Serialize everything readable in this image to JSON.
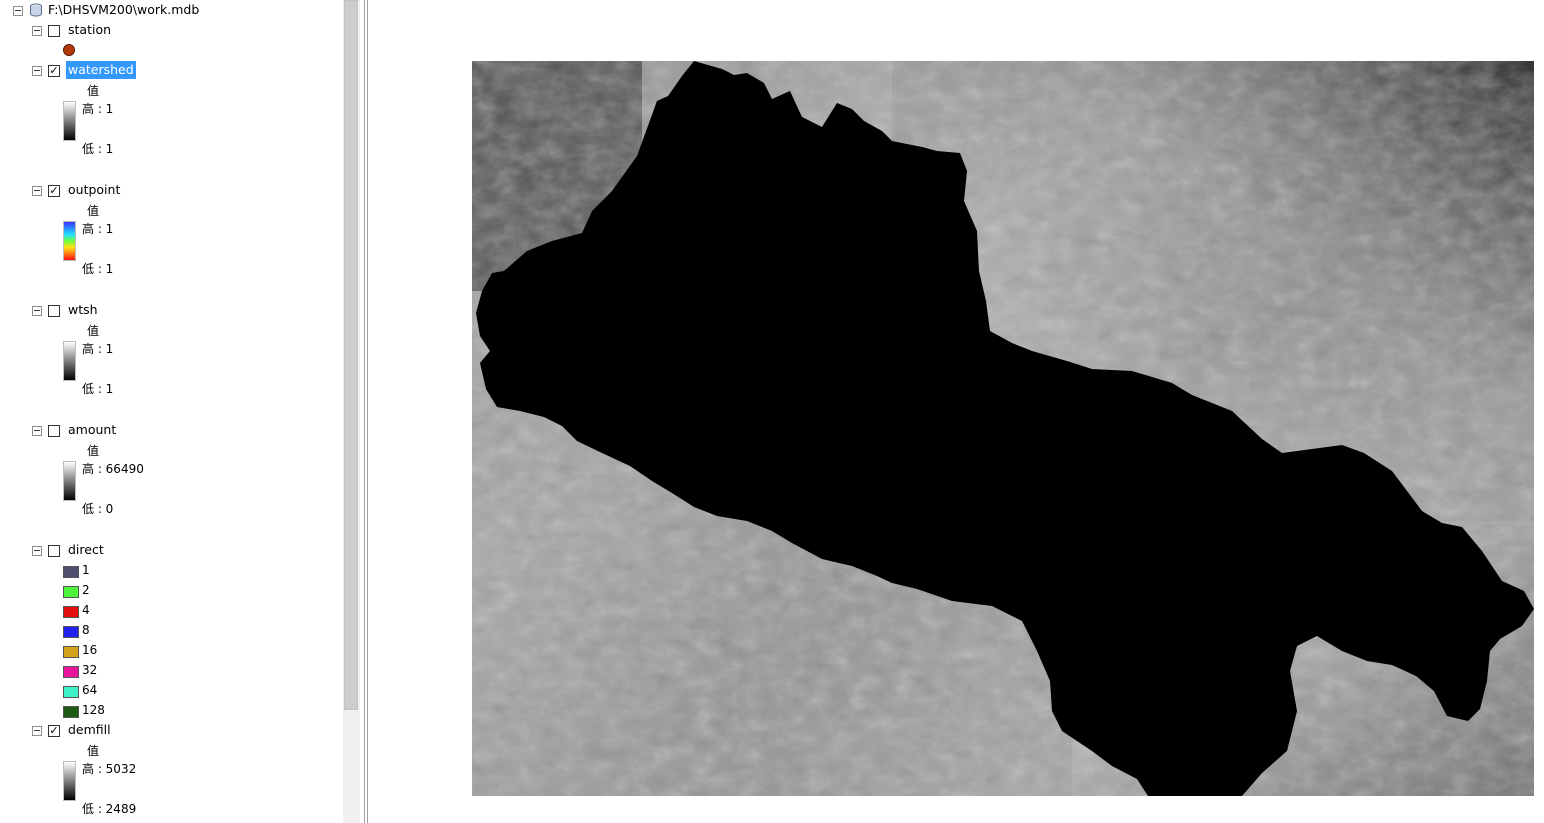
{
  "toc": {
    "workspace": {
      "label": "F:\\DHSVM200\\work.mdb",
      "icon": "database-icon"
    },
    "value_header": "值",
    "layers": {
      "station": {
        "name": "station",
        "checked": false,
        "symbol_color": "#b43a0a"
      },
      "watershed": {
        "name": "watershed",
        "checked": true,
        "selected": true,
        "high": "高 : 1",
        "low": "低 : 1"
      },
      "outpoint": {
        "name": "outpoint",
        "checked": true,
        "high": "高 : 1",
        "low": "低 : 1"
      },
      "wtsh": {
        "name": "wtsh",
        "checked": false,
        "high": "高 : 1",
        "low": "低 : 1"
      },
      "amount": {
        "name": "amount",
        "checked": false,
        "high": "高 : 66490",
        "low": "低 : 0"
      },
      "direct": {
        "name": "direct",
        "checked": false,
        "classes": [
          {
            "label": "1",
            "color": "#4e4e6e"
          },
          {
            "label": "2",
            "color": "#4cf53a"
          },
          {
            "label": "4",
            "color": "#e21010"
          },
          {
            "label": "8",
            "color": "#2222ee"
          },
          {
            "label": "16",
            "color": "#d3a31c"
          },
          {
            "label": "32",
            "color": "#e8169a"
          },
          {
            "label": "64",
            "color": "#3cf0c8"
          },
          {
            "label": "128",
            "color": "#1e5a16"
          }
        ]
      },
      "demfill": {
        "name": "demfill",
        "checked": true,
        "high": "高 : 5032",
        "low": "低 : 2489"
      }
    }
  },
  "map": {
    "description_icon": "raster-map",
    "watershed_color": "#000000",
    "background": "#ffffff"
  }
}
